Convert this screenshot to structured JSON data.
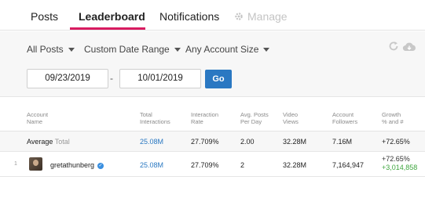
{
  "tabs": [
    {
      "label": "Posts"
    },
    {
      "label": "Leaderboard"
    },
    {
      "label": "Notifications"
    },
    {
      "label": "Manage"
    }
  ],
  "filters": {
    "posts": "All Posts",
    "date_range": "Custom Date Range",
    "account_size": "Any Account Size"
  },
  "date": {
    "start": "09/23/2019",
    "separator": "-",
    "end": "10/01/2019",
    "go_label": "Go"
  },
  "table": {
    "headers": [
      {
        "line1": "Account",
        "line2": "Name"
      },
      {
        "line1": "Total",
        "line2": "Interactions"
      },
      {
        "line1": "Interaction",
        "line2": "Rate"
      },
      {
        "line1": "Avg. Posts",
        "line2": "Per Day"
      },
      {
        "line1": "Video",
        "line2": "Views"
      },
      {
        "line1": "Account",
        "line2": "Followers"
      },
      {
        "line1": "Growth",
        "line2": "% and #"
      }
    ],
    "average": {
      "label": "Average",
      "sublabel": "Total",
      "interactions": "25.08M",
      "rate": "27.709%",
      "posts_per_day": "2.00",
      "video_views": "32.28M",
      "followers": "7.16M",
      "growth_pct": "+72.65%"
    },
    "rows": [
      {
        "rank": "1",
        "name": "gretathunberg",
        "interactions": "25.08M",
        "rate": "27.709%",
        "posts_per_day": "2",
        "video_views": "32.28M",
        "followers": "7,164,947",
        "growth_pct": "+72.65%",
        "growth_num": "+3,014,858"
      }
    ]
  },
  "colors": {
    "accent": "#d81b60",
    "link": "#2a78c2",
    "positive": "#3fa63f"
  },
  "icons": [
    "gear-icon",
    "refresh-icon",
    "cloud-download-icon",
    "verified-icon",
    "caret-down-icon"
  ]
}
